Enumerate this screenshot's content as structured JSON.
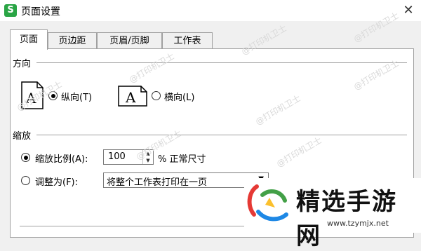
{
  "window": {
    "app_icon_letter": "S",
    "title": "页面设置",
    "close_glyph": "✕"
  },
  "tabs": [
    {
      "label": "页面",
      "active": true
    },
    {
      "label": "页边距",
      "active": false
    },
    {
      "label": "页眉/页脚",
      "active": false
    },
    {
      "label": "工作表",
      "active": false
    }
  ],
  "orientation": {
    "group_label": "方向",
    "portrait": {
      "label": "纵向(T)",
      "checked": true,
      "icon_letter": "A"
    },
    "landscape": {
      "label": "横向(L)",
      "checked": false,
      "icon_letter": "A"
    }
  },
  "scaling": {
    "group_label": "缩放",
    "scale_ratio": {
      "label": "缩放比例(A):",
      "checked": true,
      "value": "100",
      "suffix": "% 正常尺寸"
    },
    "fit_to": {
      "label": "调整为(F):",
      "checked": false,
      "selected": "将整个工作表打印在一页"
    }
  },
  "watermark": {
    "text": "@打印机卫士"
  },
  "brand": {
    "name": "精选手游网",
    "url": "www.tzymjx.net"
  }
}
